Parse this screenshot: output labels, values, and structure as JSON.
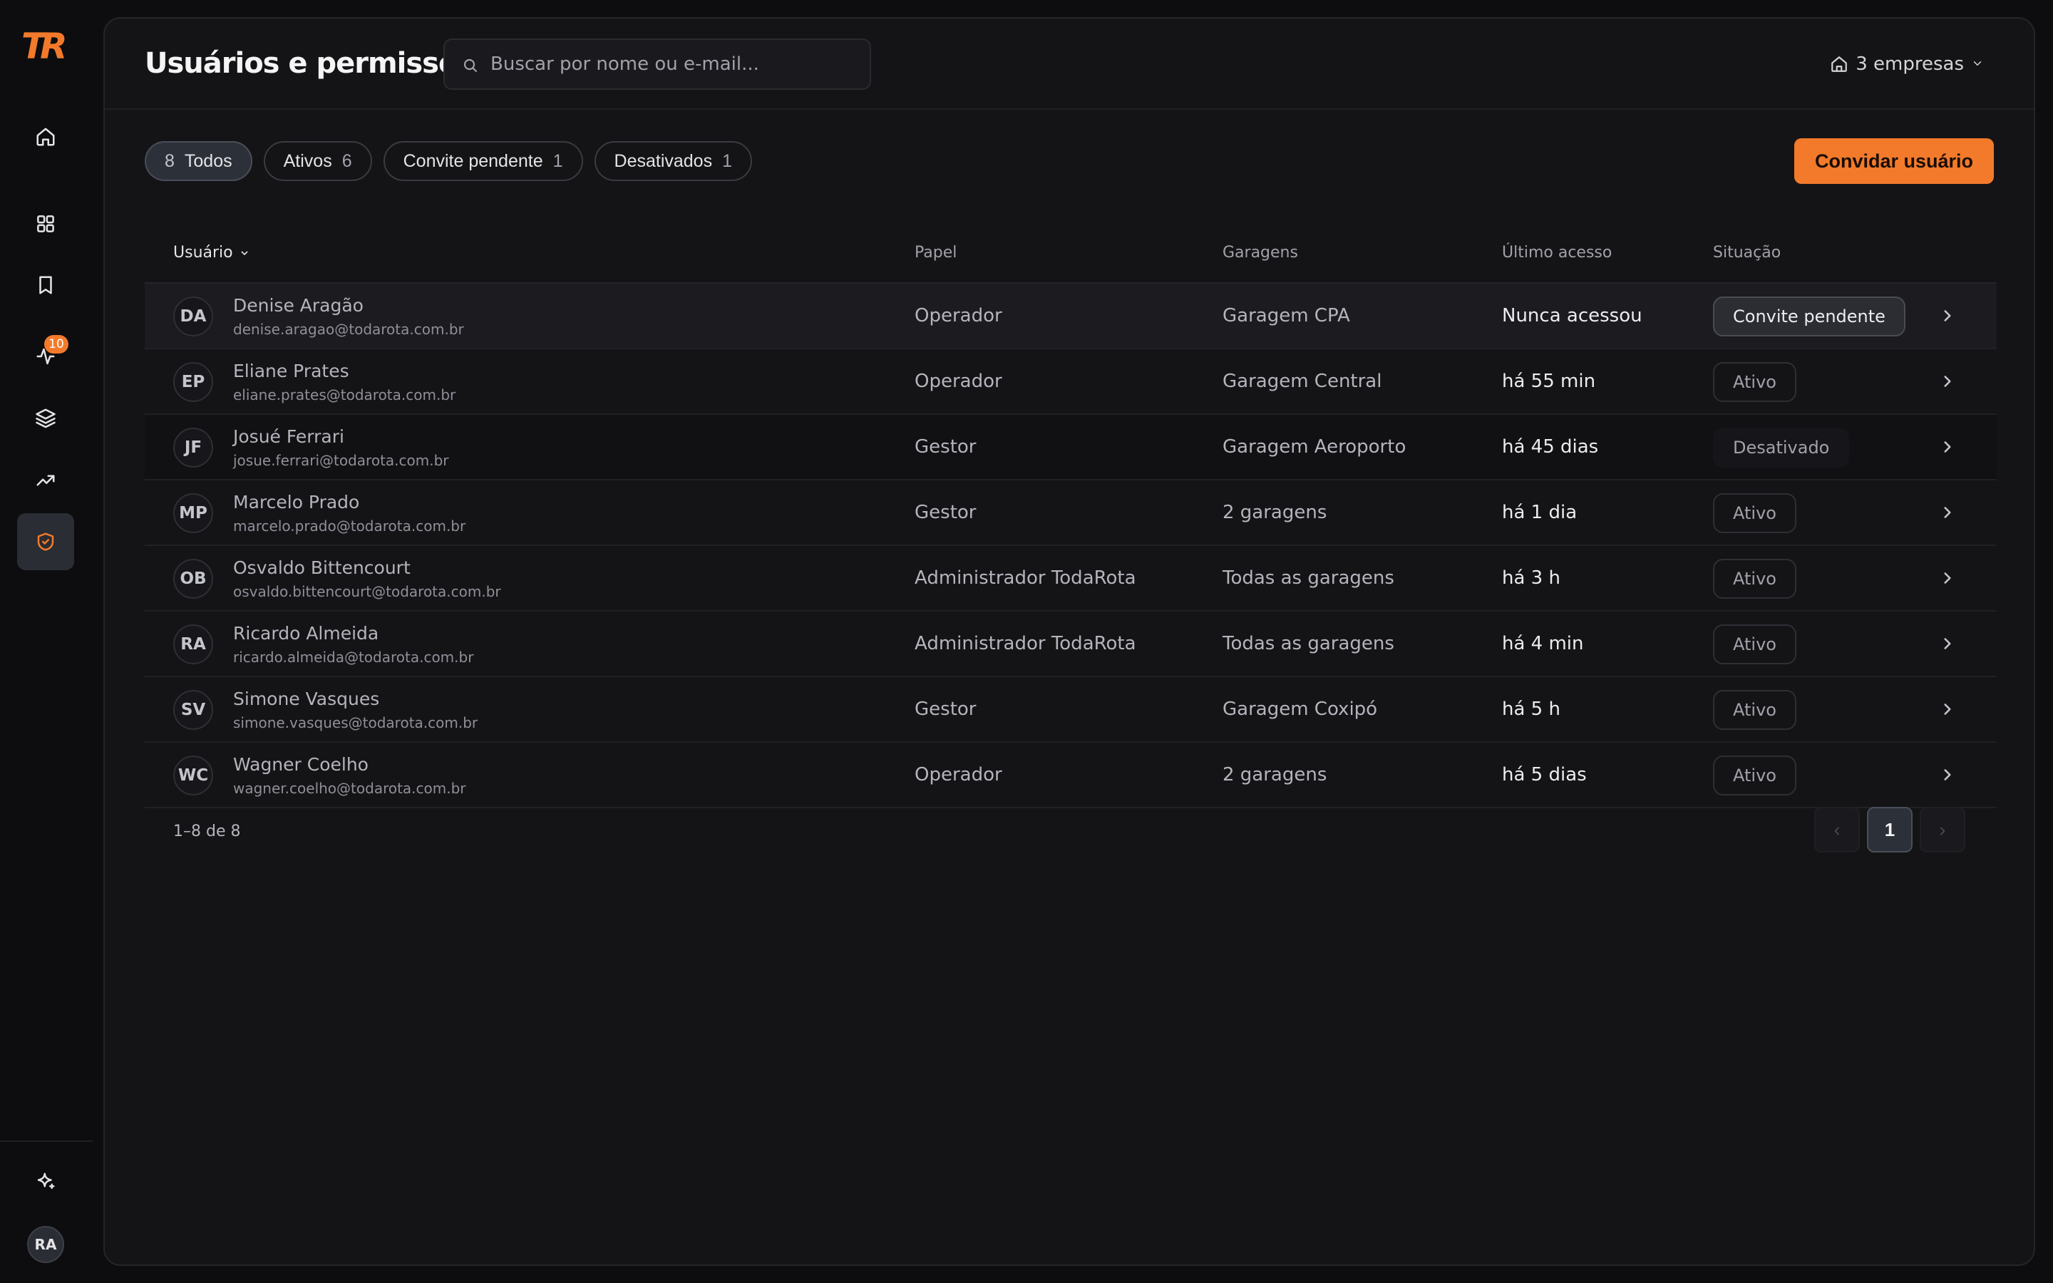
{
  "brand": {
    "logo_text": "TR",
    "accent": "#f37a2b"
  },
  "sidebar": {
    "nav": [
      {
        "icon": "home-icon"
      },
      {
        "icon": "grid-icon"
      },
      {
        "icon": "bookmark-icon"
      },
      {
        "icon": "activity-icon",
        "badge": "10"
      },
      {
        "icon": "layers-icon"
      },
      {
        "icon": "trending-up-icon"
      },
      {
        "icon": "shield-check-icon",
        "active": true
      }
    ],
    "bottom": {
      "sparkle_icon": "sparkles-icon",
      "user_initials": "RA"
    }
  },
  "header": {
    "title": "Usuários e permissões",
    "search_placeholder": "Buscar por nome ou e-mail...",
    "company_label": "3 empresas"
  },
  "filters": [
    {
      "count": "8",
      "label": "Todos",
      "active": true
    },
    {
      "label": "Ativos",
      "count": "6"
    },
    {
      "label": "Convite pendente",
      "count": "1"
    },
    {
      "label": "Desativados",
      "count": "1"
    }
  ],
  "invite_button": "Convidar usuário",
  "table": {
    "columns": {
      "user": "Usuário",
      "role": "Papel",
      "garages": "Garagens",
      "last_access": "Último acesso",
      "status": "Situação"
    },
    "rows": [
      {
        "initials": "DA",
        "name": "Denise Aragão",
        "email": "denise.aragao@todarota.com.br",
        "role": "Operador",
        "garages": "Garagem CPA",
        "last_access": "Nunca acessou",
        "status": "Convite pendente",
        "status_kind": "pending"
      },
      {
        "initials": "EP",
        "name": "Eliane Prates",
        "email": "eliane.prates@todarota.com.br",
        "role": "Operador",
        "garages": "Garagem Central",
        "last_access": "há 55 min",
        "status": "Ativo",
        "status_kind": "active"
      },
      {
        "initials": "JF",
        "name": "Josué Ferrari",
        "email": "josue.ferrari@todarota.com.br",
        "role": "Gestor",
        "garages": "Garagem Aeroporto",
        "last_access": "há 45 dias",
        "status": "Desativado",
        "status_kind": "off"
      },
      {
        "initials": "MP",
        "name": "Marcelo Prado",
        "email": "marcelo.prado@todarota.com.br",
        "role": "Gestor",
        "garages": "2 garagens",
        "last_access": "há 1 dia",
        "status": "Ativo",
        "status_kind": "active"
      },
      {
        "initials": "OB",
        "name": "Osvaldo Bittencourt",
        "email": "osvaldo.bittencourt@todarota.com.br",
        "role": "Administrador TodaRota",
        "garages": "Todas as garagens",
        "last_access": "há 3 h",
        "status": "Ativo",
        "status_kind": "active"
      },
      {
        "initials": "RA",
        "name": "Ricardo Almeida",
        "email": "ricardo.almeida@todarota.com.br",
        "role": "Administrador TodaRota",
        "garages": "Todas as garagens",
        "last_access": "há 4 min",
        "status": "Ativo",
        "status_kind": "active"
      },
      {
        "initials": "SV",
        "name": "Simone Vasques",
        "email": "simone.vasques@todarota.com.br",
        "role": "Gestor",
        "garages": "Garagem Coxipó",
        "last_access": "há 5 h",
        "status": "Ativo",
        "status_kind": "active"
      },
      {
        "initials": "WC",
        "name": "Wagner Coelho",
        "email": "wagner.coelho@todarota.com.br",
        "role": "Operador",
        "garages": "2 garagens",
        "last_access": "há 5 dias",
        "status": "Ativo",
        "status_kind": "active"
      }
    ]
  },
  "pagination": {
    "range": "1–8 de 8",
    "prev": "‹",
    "current": "1",
    "next": "›"
  }
}
